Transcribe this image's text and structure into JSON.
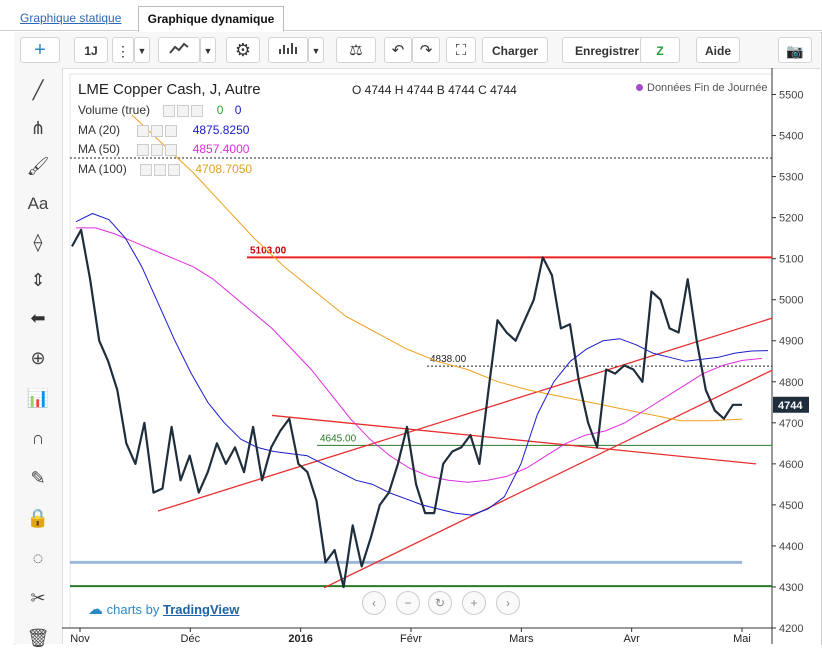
{
  "tabs": [
    "Graphique statique",
    "Graphique dynamique"
  ],
  "toolbar": {
    "interval": "1J",
    "buttons": [
      "Charger",
      "Enregistrer",
      "Aide"
    ]
  },
  "legend": {
    "title": "LME Copper Cash, J, Autre",
    "ohlc": "O 4744  H 4744  B 4744  C 4744",
    "eod": "Données Fin de Journée",
    "volume_label": "Volume (true)",
    "volume_vals": [
      "0",
      "0"
    ],
    "ma20_label": "MA (20)",
    "ma20_value": "4875.8250",
    "ma50_label": "MA (50)",
    "ma50_value": "4857.4000",
    "ma100_label": "MA (100)",
    "ma100_value": "4708.7050"
  },
  "brand": {
    "prefix": "charts by",
    "name": "TradingView"
  },
  "colors": {
    "price": "#1f2e3d",
    "ma20": "#1a1acc",
    "ma50": "#e02ce0",
    "ma100": "#f0a020",
    "resistance": "#ee2222",
    "support": "#2a7a2a",
    "trend": "#e63030"
  },
  "chart_data": {
    "type": "line",
    "xlabels": [
      "Nov",
      "Déc",
      "2016",
      "Févr",
      "Mars",
      "Avr",
      "Mai"
    ],
    "ylim": [
      4200,
      5550
    ],
    "yticks": [
      4200,
      4300,
      4400,
      4500,
      4600,
      4700,
      4800,
      4900,
      5000,
      5100,
      5200,
      5300,
      5400,
      5500
    ],
    "last_price": "4744",
    "levels": [
      {
        "label": "5103.00",
        "value": 5103
      },
      {
        "label": "4838.00",
        "value": 4838
      },
      {
        "label": "4645.00",
        "value": 4645
      }
    ],
    "price": [
      5130,
      5170,
      5050,
      4900,
      4850,
      4780,
      4650,
      4600,
      4700,
      4530,
      4540,
      4690,
      4560,
      4620,
      4530,
      4580,
      4650,
      4600,
      4640,
      4580,
      4690,
      4560,
      4640,
      4680,
      4710,
      4600,
      4580,
      4510,
      4360,
      4390,
      4300,
      4450,
      4350,
      4420,
      4500,
      4530,
      4600,
      4690,
      4550,
      4480,
      4480,
      4600,
      4630,
      4640,
      4670,
      4600,
      4780,
      4950,
      4920,
      4900,
      4950,
      5000,
      5103,
      5060,
      4930,
      4940,
      4800,
      4700,
      4640,
      4830,
      4820,
      4840,
      4830,
      4800,
      5020,
      5000,
      4930,
      4920,
      5050,
      4900,
      4780,
      4730,
      4710,
      4744,
      4744
    ],
    "ma20": [
      5190,
      5210,
      5195,
      5150,
      5080,
      4990,
      4900,
      4820,
      4750,
      4700,
      4660,
      4640,
      4630,
      4625,
      4620,
      4600,
      4580,
      4560,
      4550,
      4530,
      4515,
      4500,
      4490,
      4480,
      4475,
      4490,
      4520,
      4600,
      4720,
      4800,
      4850,
      4880,
      4900,
      4905,
      4890,
      4870,
      4860,
      4850,
      4855,
      4860,
      4870,
      4875,
      4876
    ],
    "ma50": [
      5175,
      5175,
      5160,
      5140,
      5120,
      5100,
      5080,
      5050,
      5010,
      4970,
      4930,
      4880,
      4830,
      4770,
      4710,
      4660,
      4620,
      4590,
      4570,
      4560,
      4555,
      4560,
      4570,
      4590,
      4620,
      4650,
      4670,
      4680,
      4700,
      4730,
      4760,
      4790,
      4820,
      4840,
      4852,
      4857
    ],
    "ma100": [
      5450,
      5380,
      5310,
      5230,
      5150,
      5080,
      5020,
      4960,
      4920,
      4880,
      4850,
      4830,
      4800,
      4780,
      4765,
      4750,
      4735,
      4720,
      4705,
      4705,
      4709
    ]
  }
}
